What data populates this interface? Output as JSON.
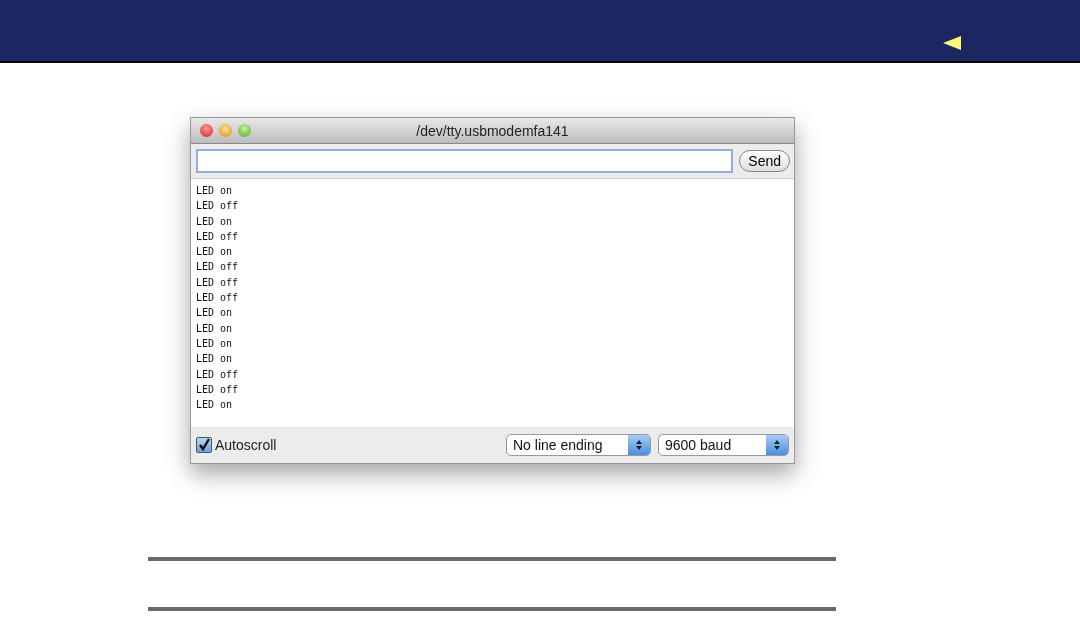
{
  "window": {
    "title": "/dev/tty.usbmodemfa141"
  },
  "send_button": "Send",
  "log_lines": [
    "LED on",
    "LED off",
    "LED on",
    "LED off",
    "LED on",
    "LED off",
    "LED off",
    "LED off",
    "LED on",
    "LED on",
    "LED on",
    "LED on",
    "LED off",
    "LED off",
    "LED on"
  ],
  "autoscroll": {
    "label": "Autoscroll",
    "checked": true
  },
  "line_ending": "No line ending",
  "baud_rate": "9600 baud"
}
